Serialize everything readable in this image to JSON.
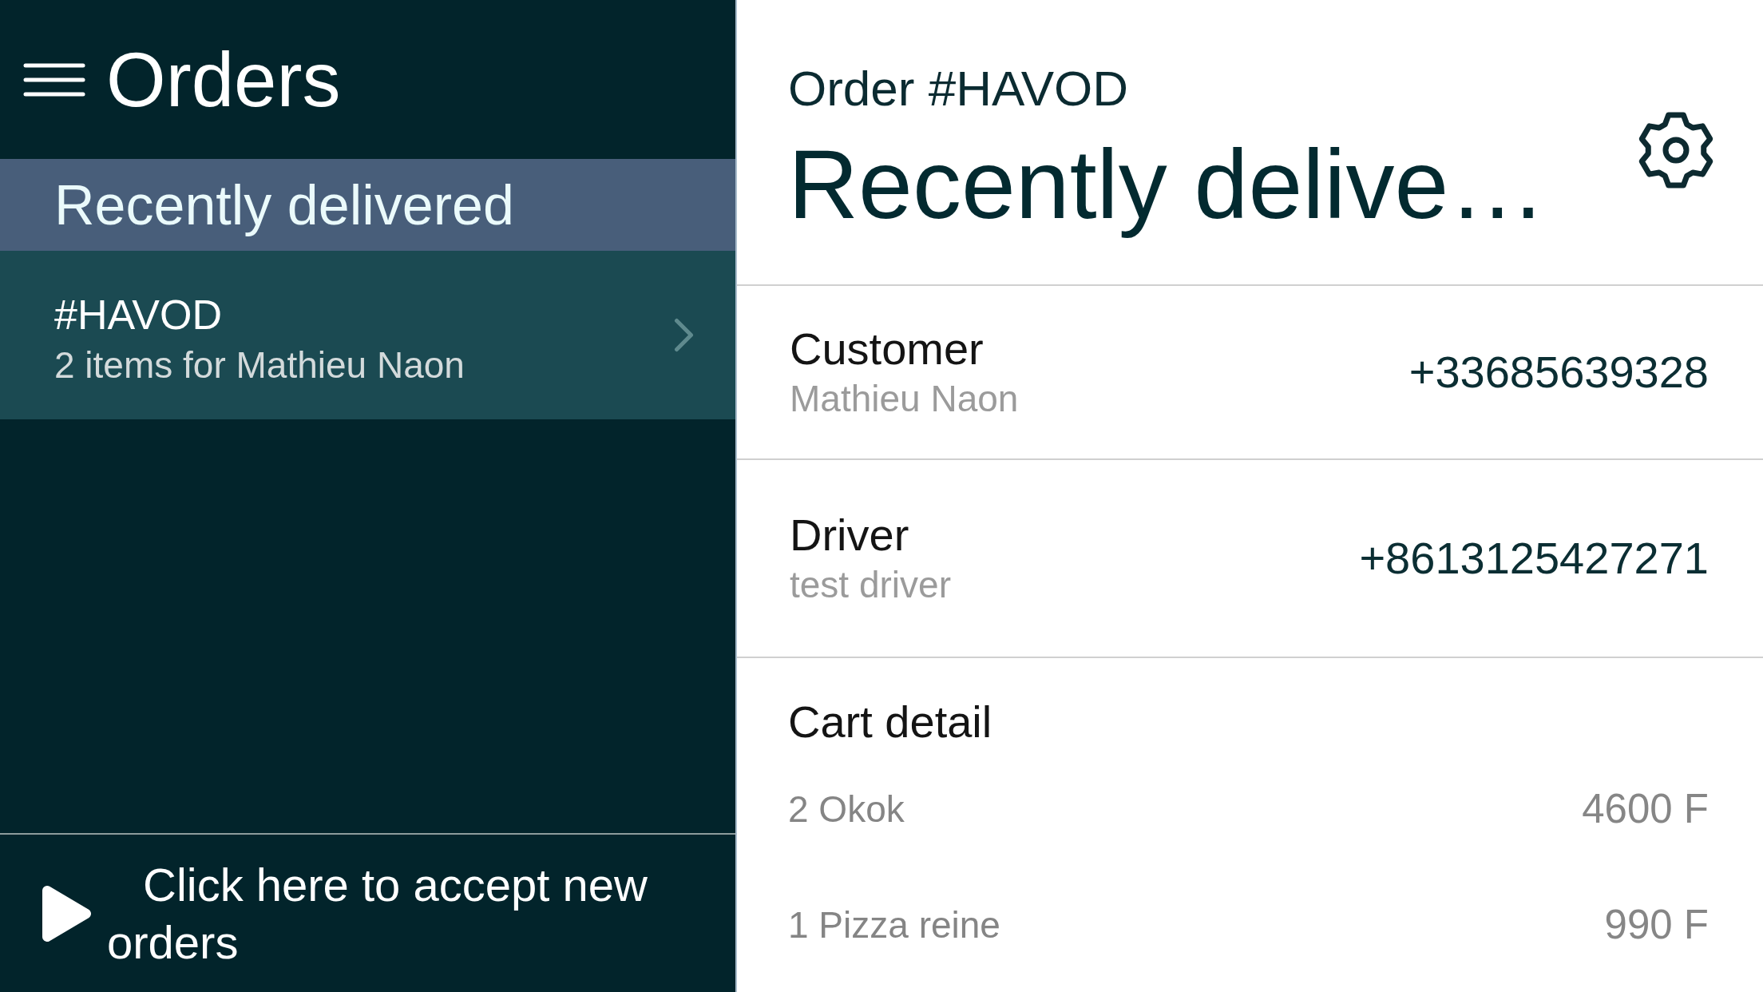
{
  "sidebar": {
    "title": "Orders",
    "section": "Recently delivered",
    "orders": [
      {
        "code": "#HAVOD",
        "summary": "2 items for Mathieu Naon",
        "selected": true
      }
    ],
    "accept_button": "Click here to accept new orders"
  },
  "detail": {
    "subtitle": "Order #HAVOD",
    "title": "Recently delive…",
    "contacts": [
      {
        "label": "Customer",
        "name": "Mathieu Naon",
        "phone": "+33685639328"
      },
      {
        "label": "Driver",
        "name": "test driver",
        "phone": "+8613125427271"
      }
    ],
    "cart": {
      "title": "Cart detail",
      "items": [
        {
          "name": "2 Okok",
          "price": "4600 F"
        },
        {
          "name": "1 Pizza reine",
          "price": "990 F"
        }
      ]
    }
  }
}
